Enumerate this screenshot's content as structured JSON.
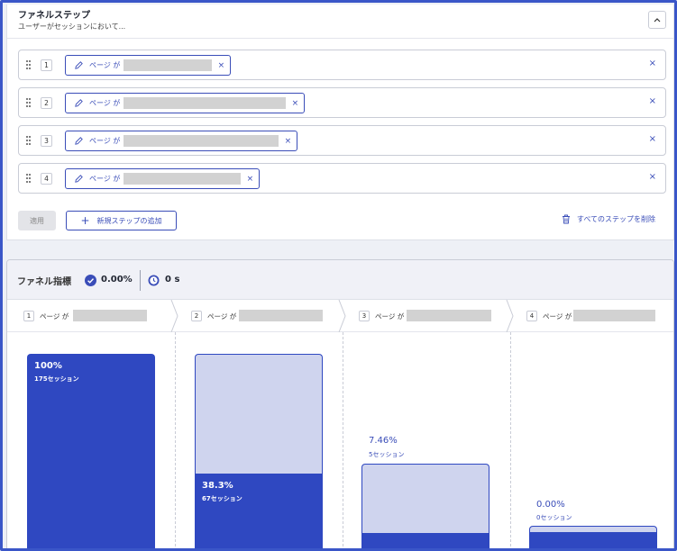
{
  "funnel_steps": {
    "title": "ファネルステップ",
    "subtitle": "ユーザーがセッションにおいて...",
    "collapse_icon": "chevron-up-icon",
    "steps": [
      {
        "number": "1",
        "condition": "ページ が"
      },
      {
        "number": "2",
        "condition": "ページ が"
      },
      {
        "number": "3",
        "condition": "ページ が"
      },
      {
        "number": "4",
        "condition": "ページ が"
      }
    ],
    "chip_remove": "×",
    "row_remove": "×",
    "apply_label": "適用",
    "add_step_label": "新規ステップの追加",
    "add_step_icon": "+",
    "delete_all_label": "すべてのステップを削除"
  },
  "funnel_metrics": {
    "title": "ファネル指標",
    "conversion_rate": "0.00%",
    "avg_time": "0 s",
    "columns": [
      {
        "number": "1",
        "label": "ページ が",
        "percent": "100%",
        "sessions": "175セッション"
      },
      {
        "number": "2",
        "label": "ページ が",
        "percent": "38.3%",
        "sessions": "67セッション"
      },
      {
        "number": "3",
        "label": "ページ が",
        "percent": "7.46%",
        "sessions": "5セッション"
      },
      {
        "number": "4",
        "label": "ページ が",
        "percent": "0.00%",
        "sessions": "0セッション"
      }
    ]
  },
  "colors": {
    "accent": "#3a4db8",
    "bar_primary": "#2f48c1",
    "bar_secondary": "#cfd4ee",
    "redaction": "#d2d2d2",
    "frame": "#3a56c8"
  }
}
